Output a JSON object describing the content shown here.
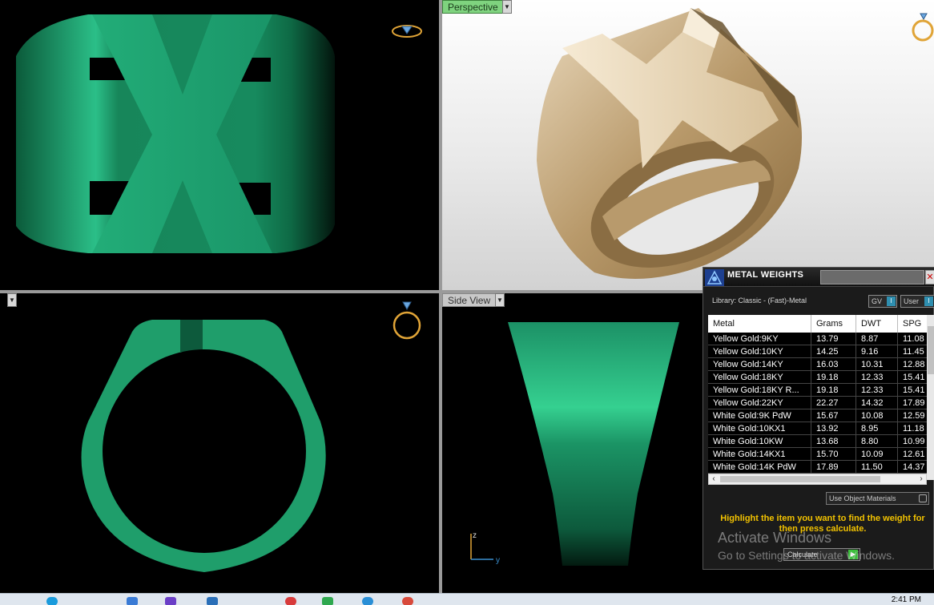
{
  "viewports": {
    "top_left": {
      "label": ""
    },
    "top_right": {
      "label": "Perspective"
    },
    "bottom_left": {
      "label": ""
    },
    "bottom_right": {
      "label": "Side View"
    }
  },
  "axis": {
    "z": "z",
    "y": "y"
  },
  "metal_weights": {
    "title": "METAL WEIGHTS",
    "library": "Library: Classic - (Fast)-Metal",
    "gv_label": "GV",
    "user_label": "User",
    "columns": [
      "Metal",
      "Grams",
      "DWT",
      "SPG"
    ],
    "rows": [
      {
        "metal": "Yellow Gold:9KY",
        "grams": "13.79",
        "dwt": "8.87",
        "spg": "11.08"
      },
      {
        "metal": "Yellow Gold:10KY",
        "grams": "14.25",
        "dwt": "9.16",
        "spg": "11.45"
      },
      {
        "metal": "Yellow Gold:14KY",
        "grams": "16.03",
        "dwt": "10.31",
        "spg": "12.88"
      },
      {
        "metal": "Yellow Gold:18KY",
        "grams": "19.18",
        "dwt": "12.33",
        "spg": "15.41"
      },
      {
        "metal": "Yellow Gold:18KY R...",
        "grams": "19.18",
        "dwt": "12.33",
        "spg": "15.41"
      },
      {
        "metal": "Yellow Gold:22KY",
        "grams": "22.27",
        "dwt": "14.32",
        "spg": "17.89"
      },
      {
        "metal": "White Gold:9K PdW",
        "grams": "15.67",
        "dwt": "10.08",
        "spg": "12.59"
      },
      {
        "metal": "White Gold:10KX1",
        "grams": "13.92",
        "dwt": "8.95",
        "spg": "11.18"
      },
      {
        "metal": "White Gold:10KW",
        "grams": "13.68",
        "dwt": "8.80",
        "spg": "10.99"
      },
      {
        "metal": "White Gold:14KX1",
        "grams": "15.70",
        "dwt": "10.09",
        "spg": "12.61"
      },
      {
        "metal": "White Gold:14K PdW",
        "grams": "17.89",
        "dwt": "11.50",
        "spg": "14.37"
      }
    ],
    "use_object_materials": "Use Object Materials",
    "hint": "Highlight the item you want to find the weight for then press calculate.",
    "calculate": "Calculate"
  },
  "watermark": {
    "line1": "Activate Windows",
    "line2": "Go to Settings to activate Windows."
  },
  "clock": "2:41 PM",
  "colors": {
    "ring_green": "#1f9e6b",
    "gold": "#c9b28a",
    "hint_yellow": "#f2c200",
    "label_green": "#7fd37f"
  }
}
